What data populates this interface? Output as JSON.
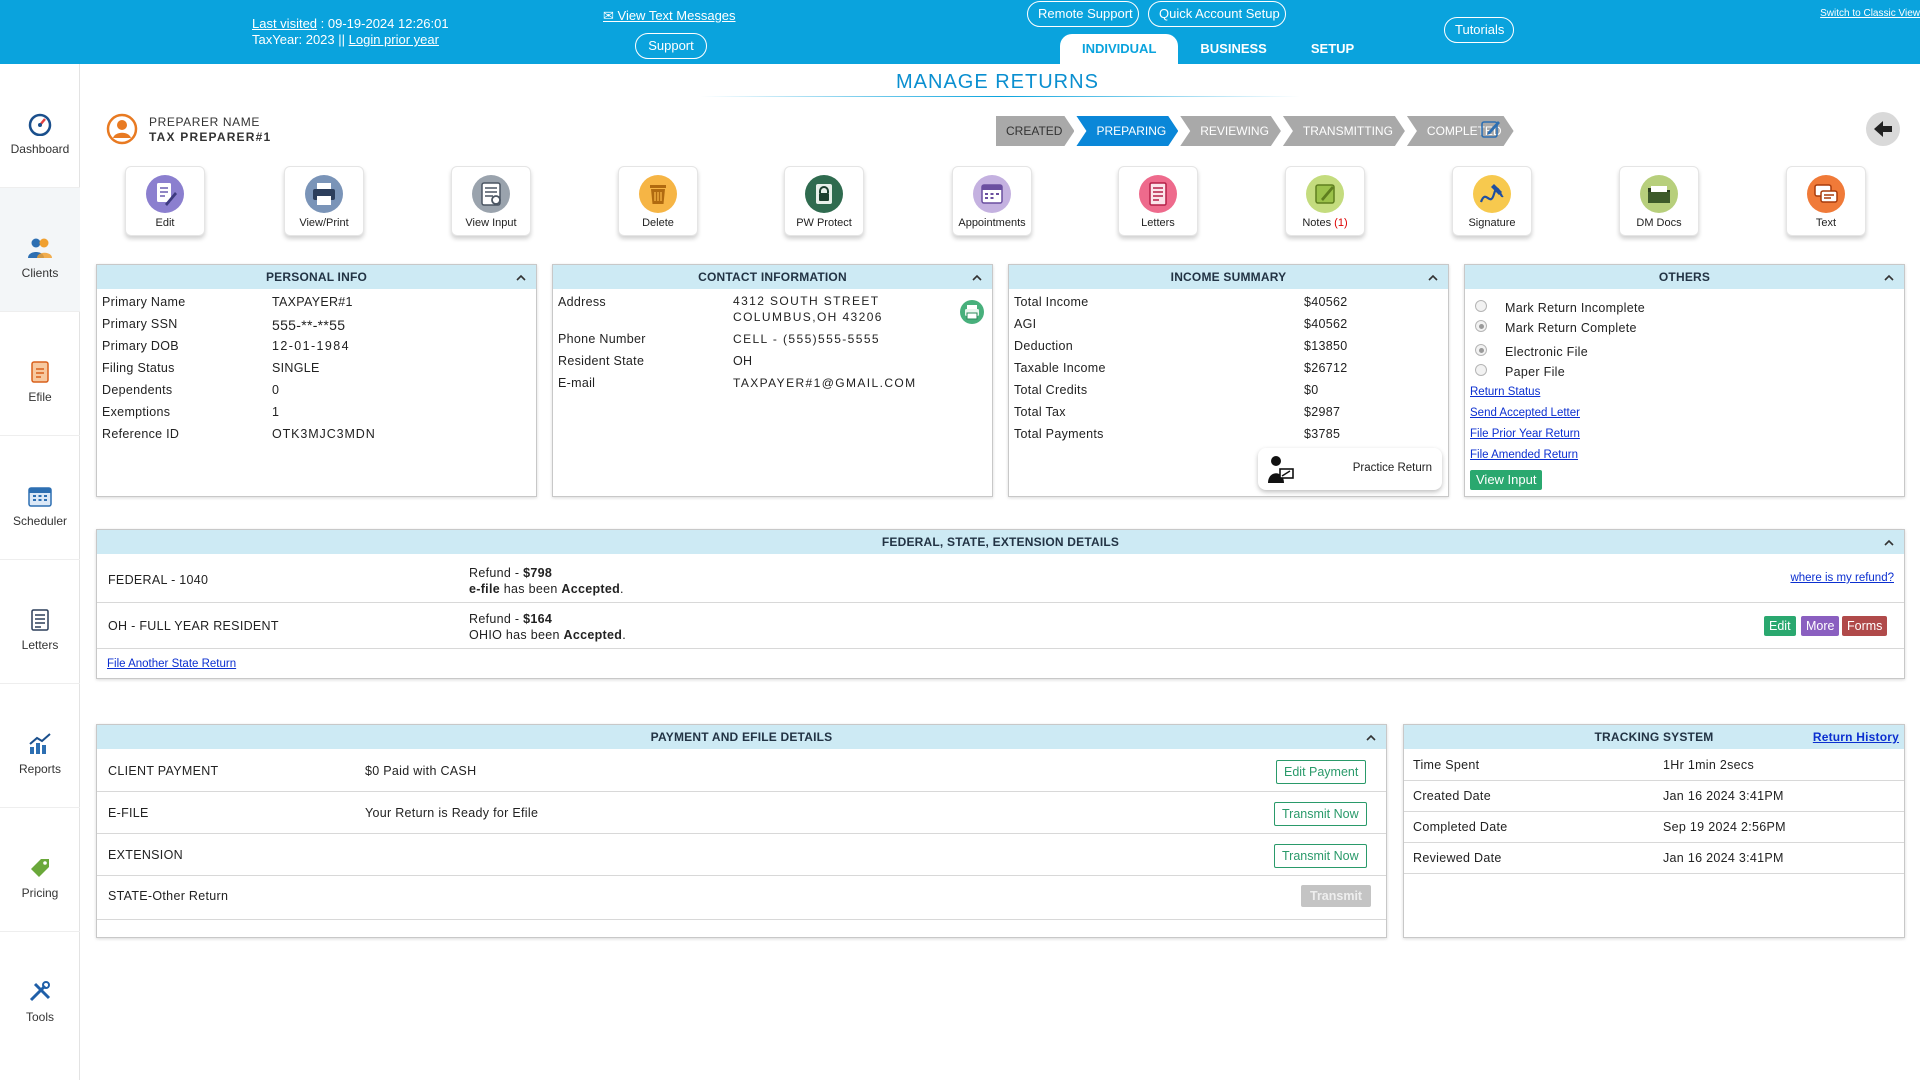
{
  "header": {
    "last_visited_label": "Last visited",
    "last_visited_value": " : 09-19-2024 12:26:01",
    "tax_year_label": "TaxYear:  2023  || ",
    "login_prior_year": "Login prior year",
    "view_text_messages": "✉ View Text Messages",
    "support": "Support",
    "remote_support": "Remote Support",
    "quick_account_setup": "Quick Account Setup",
    "tutorials": "Tutorials",
    "switch_classic": "Switch to Classic View",
    "tabs": [
      "INDIVIDUAL",
      "BUSINESS",
      "SETUP"
    ]
  },
  "sidebar": {
    "items": [
      {
        "label": "Dashboard",
        "icon": "gauge-icon"
      },
      {
        "label": "Clients",
        "icon": "users-icon"
      },
      {
        "label": "Efile",
        "icon": "efile-icon"
      },
      {
        "label": "Scheduler",
        "icon": "calendar-icon"
      },
      {
        "label": "Letters",
        "icon": "document-icon"
      },
      {
        "label": "Reports",
        "icon": "chart-icon"
      },
      {
        "label": "Pricing",
        "icon": "price-tag-icon"
      },
      {
        "label": "Tools",
        "icon": "tools-icon"
      }
    ]
  },
  "page_title": "MANAGE RETURNS",
  "preparer": {
    "label": "PREPARER NAME",
    "name": "TAX PREPARER#1"
  },
  "steps": [
    {
      "label": "CREATED",
      "active": false
    },
    {
      "label": "PREPARING",
      "active": true
    },
    {
      "label": "REVIEWING",
      "active": false
    },
    {
      "label": "TRANSMITTING",
      "active": false
    },
    {
      "label": "COMPLETED",
      "active": false
    }
  ],
  "actions": [
    {
      "label": "Edit",
      "icon": "edit-icon",
      "color": "#6b5fb0"
    },
    {
      "label": "View/Print",
      "icon": "printer-icon",
      "color": "#3d5a80"
    },
    {
      "label": "View Input",
      "icon": "view-input-icon",
      "color": "#707a85"
    },
    {
      "label": "Delete",
      "icon": "trash-icon",
      "color": "#f0a030"
    },
    {
      "label": "PW Protect",
      "icon": "lock-icon",
      "color": "#2f6b4f"
    },
    {
      "label": "Appointments",
      "icon": "calendar-icon",
      "color": "#8a6fb8"
    },
    {
      "label": "Letters",
      "icon": "letter-icon",
      "color": "#d9436a"
    },
    {
      "label": "Notes",
      "count": "(1)",
      "icon": "note-icon",
      "color": "#9bc24a"
    },
    {
      "label": "Signature",
      "icon": "signature-icon",
      "color": "#f2b42c"
    },
    {
      "label": "DM Docs",
      "icon": "folder-icon",
      "color": "#6c8e3a"
    },
    {
      "label": "Text",
      "icon": "chat-icon",
      "color": "#e8581c"
    }
  ],
  "personal_info": {
    "title": "PERSONAL INFO",
    "rows": [
      {
        "label": "Primary Name",
        "value": "TAXPAYER#1"
      },
      {
        "label": "Primary SSN",
        "value": "555-**-**55"
      },
      {
        "label": "Primary DOB",
        "value": "12-01-1984"
      },
      {
        "label": "Filing Status",
        "value": "SINGLE"
      },
      {
        "label": "Dependents",
        "value": "0"
      },
      {
        "label": "Exemptions",
        "value": "1"
      },
      {
        "label": "Reference ID",
        "value": "OTK3MJC3MDN"
      }
    ]
  },
  "contact_info": {
    "title": "CONTACT INFORMATION",
    "address_label": "Address",
    "address_line1": "4312 SOUTH STREET",
    "address_line2": "COLUMBUS,OH 43206",
    "phone_label": "Phone Number",
    "phone_value": "CELL - (555)555-5555",
    "state_label": "Resident State",
    "state_value": "OH",
    "email_label": "E-mail",
    "email_value": "TAXPAYER#1@GMAIL.COM"
  },
  "income_summary": {
    "title": "INCOME SUMMARY",
    "rows": [
      {
        "label": "Total Income",
        "value": "$40562"
      },
      {
        "label": "AGI",
        "value": "$40562"
      },
      {
        "label": "Deduction",
        "value": "$13850"
      },
      {
        "label": "Taxable Income",
        "value": "$26712"
      },
      {
        "label": "Total Credits",
        "value": "$0"
      },
      {
        "label": "Total Tax",
        "value": "$2987"
      },
      {
        "label": "Total Payments",
        "value": "$3785"
      }
    ],
    "practice_return": "Practice Return"
  },
  "others": {
    "title": "OTHERS",
    "mark_incomplete": "Mark Return Incomplete",
    "mark_complete": "Mark Return Complete",
    "electronic_file": "Electronic File",
    "paper_file": "Paper File",
    "links": [
      "Return Status",
      "Send Accepted Letter",
      "File Prior Year Return",
      "File Amended Return"
    ],
    "view_input": "View Input"
  },
  "federal_state": {
    "title": "FEDERAL, STATE, EXTENSION DETAILS",
    "federal_name": "FEDERAL - 1040",
    "federal_refund_label": "Refund - ",
    "federal_refund_amount": "$798",
    "federal_efile_a": "e-file",
    "federal_efile_b": " has been ",
    "federal_efile_c": "Accepted",
    "federal_efile_d": ".",
    "where_refund": "where is my refund?",
    "state_name": "OH - FULL YEAR RESIDENT",
    "state_refund_label": "Refund - ",
    "state_refund_amount": "$164",
    "state_status_a": "OHIO has been ",
    "state_status_b": "Accepted",
    "state_status_c": ".",
    "edit": "Edit",
    "more": "More",
    "forms": "Forms",
    "file_another_state": "File Another State Return"
  },
  "payment_efile": {
    "title": "PAYMENT AND EFILE DETAILS",
    "rows": [
      {
        "label": "CLIENT PAYMENT",
        "value": "$0 Paid with CASH",
        "action": "Edit Payment"
      },
      {
        "label": "E-FILE",
        "value": "Your Return is Ready for Efile",
        "action": "Transmit Now"
      },
      {
        "label": "EXTENSION",
        "value": "",
        "action": "Transmit Now"
      },
      {
        "label": "STATE-Other Return",
        "value": "",
        "action": "Transmit"
      }
    ]
  },
  "tracking": {
    "title": "TRACKING SYSTEM",
    "return_history": "Return History",
    "rows": [
      {
        "label": "Time Spent",
        "value": "1Hr 1min 2secs"
      },
      {
        "label": "Created Date",
        "value": "Jan 16 2024 3:41PM"
      },
      {
        "label": "Completed Date",
        "value": "Sep 19 2024 2:56PM"
      },
      {
        "label": "Reviewed Date",
        "value": "Jan 16 2024 3:41PM"
      }
    ]
  },
  "colors": {
    "header": "#0aa3dd",
    "panel_header": "#cdeaf4",
    "accent": "#0a87d8",
    "green": "#2aa86f"
  }
}
